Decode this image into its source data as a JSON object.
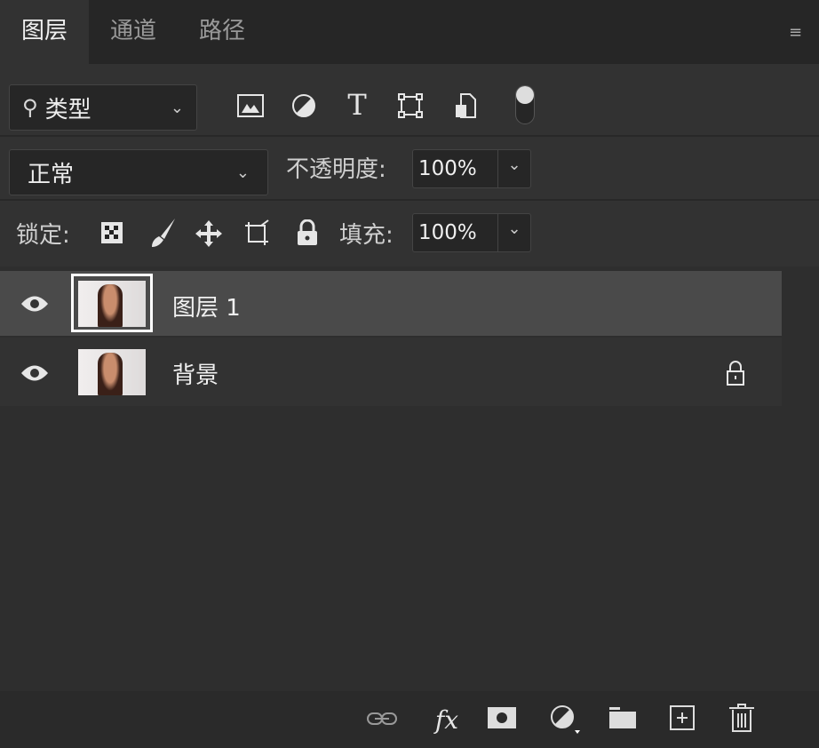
{
  "tabs": [
    {
      "label": "图层"
    },
    {
      "label": "通道"
    },
    {
      "label": "路径"
    }
  ],
  "filter": {
    "kind": "类型",
    "icons": [
      "image-filter-icon",
      "adjustment-filter-icon",
      "type-filter-icon",
      "shape-filter-icon",
      "smart-object-filter-icon",
      "filter-toggle-icon"
    ]
  },
  "blend": {
    "mode": "正常",
    "opacity_label": "不透明度:",
    "opacity": "100%"
  },
  "lock": {
    "label": "锁定:",
    "fill_label": "填充:",
    "fill": "100%"
  },
  "layers": [
    {
      "name": "图层 1",
      "visible": true,
      "selected": true,
      "locked": false
    },
    {
      "name": "背景",
      "visible": true,
      "selected": false,
      "locked": true
    }
  ],
  "colors": {
    "panel": "#323232",
    "selected_row": "#4a4a4a",
    "tabbar": "#262626"
  }
}
